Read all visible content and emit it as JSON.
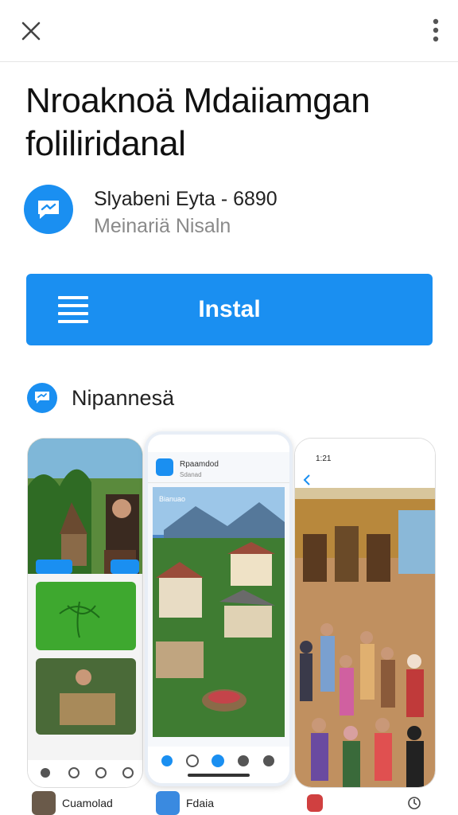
{
  "header": {
    "close_icon": "close-icon",
    "more_icon": "more-vert-icon"
  },
  "app": {
    "title": "Nroaknoä Mdaiiamgan foliliridanal",
    "developer": "Slyabeni Eyta - 6890",
    "subtitle": "Meinariä Nisaln",
    "logo_icon": "chat-bubble-icon"
  },
  "install": {
    "label": "Instal",
    "menu_icon": "hamburger-icon",
    "color": "#1a8ff1"
  },
  "language": {
    "label": "Nipannesä",
    "icon": "chat-bubble-icon"
  },
  "screenshots": {
    "p2_time": "",
    "p2_app_title": "Rpaamdod",
    "p2_app_sub": "Sdanad",
    "p2_banner": "Bianuao",
    "p3_time": "1:21"
  },
  "bottom_apps": [
    {
      "label": "Cuamolad"
    },
    {
      "label": "Fdaia"
    }
  ],
  "colors": {
    "accent": "#1a8ff1",
    "text_primary": "#111111",
    "text_secondary": "#8a8a8a"
  }
}
